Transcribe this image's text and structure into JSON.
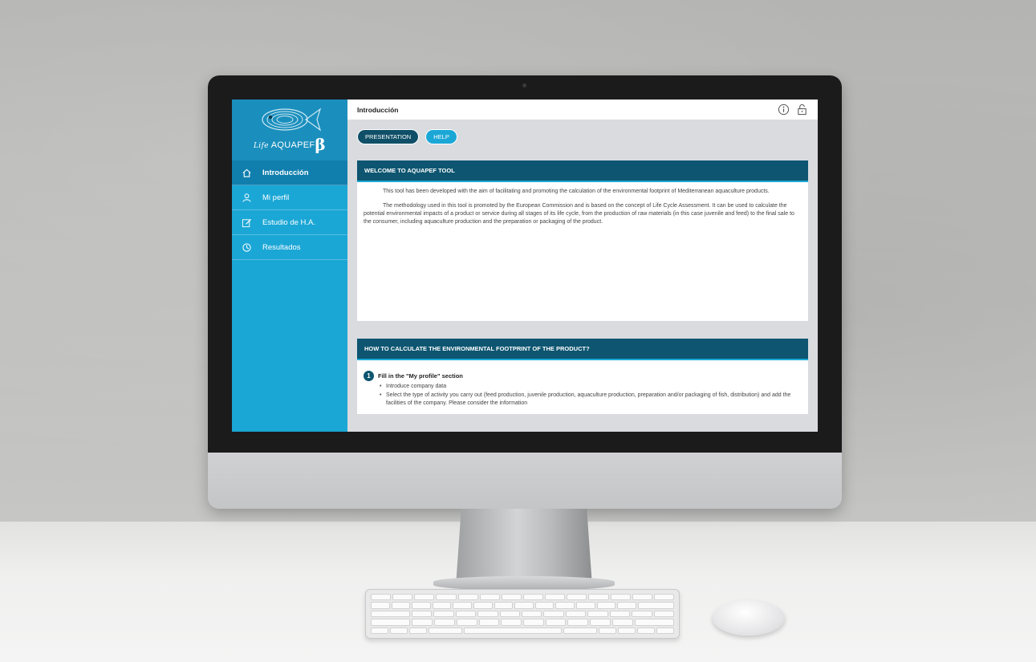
{
  "logo": {
    "life": "Life",
    "name": "AQUAPEF",
    "beta": "β"
  },
  "sidebar": {
    "items": [
      {
        "label": "Introducción",
        "icon": "home-icon",
        "active": true
      },
      {
        "label": "Mi perfil",
        "icon": "user-icon",
        "active": false
      },
      {
        "label": "Estudio de H.A.",
        "icon": "edit-icon",
        "active": false
      },
      {
        "label": "Resultados",
        "icon": "results-icon",
        "active": false
      }
    ]
  },
  "header": {
    "title": "Introducción",
    "icons": [
      "info-icon",
      "lock-icon"
    ]
  },
  "buttons": {
    "presentation": "PRESENTATION",
    "help": "HELP"
  },
  "welcome": {
    "title": "WELCOME TO AQUAPEF TOOL",
    "p1": "This tool has been developed with the aim of facilitating and promoting the calculation of the environmental footprint of Mediterranean aquaculture products.",
    "p2": "The methodology used in this tool is promoted by the European Commission and is based on the concept of Life Cycle Assessment. It can be used to calculate the potential environmental impacts of a product or service during all stages of its life cycle, from the production of raw materials (in this case juvenile and feed) to the final sale to the consumer, including aquaculture production and the preparation or packaging of the product."
  },
  "howto": {
    "title": "HOW TO CALCULATE THE ENVIRONMENTAL FOOTPRINT OF THE PRODUCT?",
    "step1": {
      "number": "1",
      "title": "Fill in the \"My profile\" section",
      "bullets": [
        "Introduce company data",
        "Select the type of activity you carry out (feed production, juvenile production, aquaculture production, preparation and/or packaging of fish, distribution) and add the facilities of the company. Please consider the information"
      ]
    }
  },
  "colors": {
    "sidebar": "#1ba7d6",
    "sidebar_active": "#117fae",
    "card_header": "#0d5570",
    "content_bg": "#d9dbdf"
  }
}
